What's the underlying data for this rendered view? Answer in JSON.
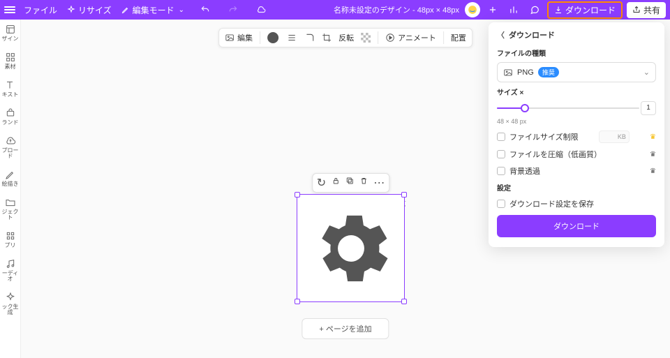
{
  "topbar": {
    "file": "ファイル",
    "resize": "リサイズ",
    "editmode": "編集モード",
    "title": "名称未設定のデザイン - 48px × 48px",
    "download": "ダウンロード",
    "share": "共有"
  },
  "rail": {
    "items": [
      {
        "label": "ザイン"
      },
      {
        "label": "素材"
      },
      {
        "label": "キスト"
      },
      {
        "label": "ランド"
      },
      {
        "label": "プロード"
      },
      {
        "label": "絵描き"
      },
      {
        "label": "ジェクト"
      },
      {
        "label": "プリ"
      },
      {
        "label": "ーディオ"
      },
      {
        "label": "ック生成"
      }
    ]
  },
  "ftool": {
    "edit": "編集",
    "flip": "反転",
    "animate": "アニメート",
    "position": "配置"
  },
  "addpage": "+ ページを追加",
  "panel": {
    "title": "ダウンロード",
    "filetype_lbl": "ファイルの種類",
    "filetype_val": "PNG",
    "filetype_badge": "推奨",
    "size_lbl": "サイズ ×",
    "size_val": "1",
    "dim": "48 × 48 px",
    "fsize_limit": "ファイルサイズ制限",
    "kb": "KB",
    "compress": "ファイルを圧縮（低画質）",
    "transparent": "背景透過",
    "settings_lbl": "設定",
    "save_settings": "ダウンロード設定を保存",
    "dl_btn": "ダウンロード"
  }
}
